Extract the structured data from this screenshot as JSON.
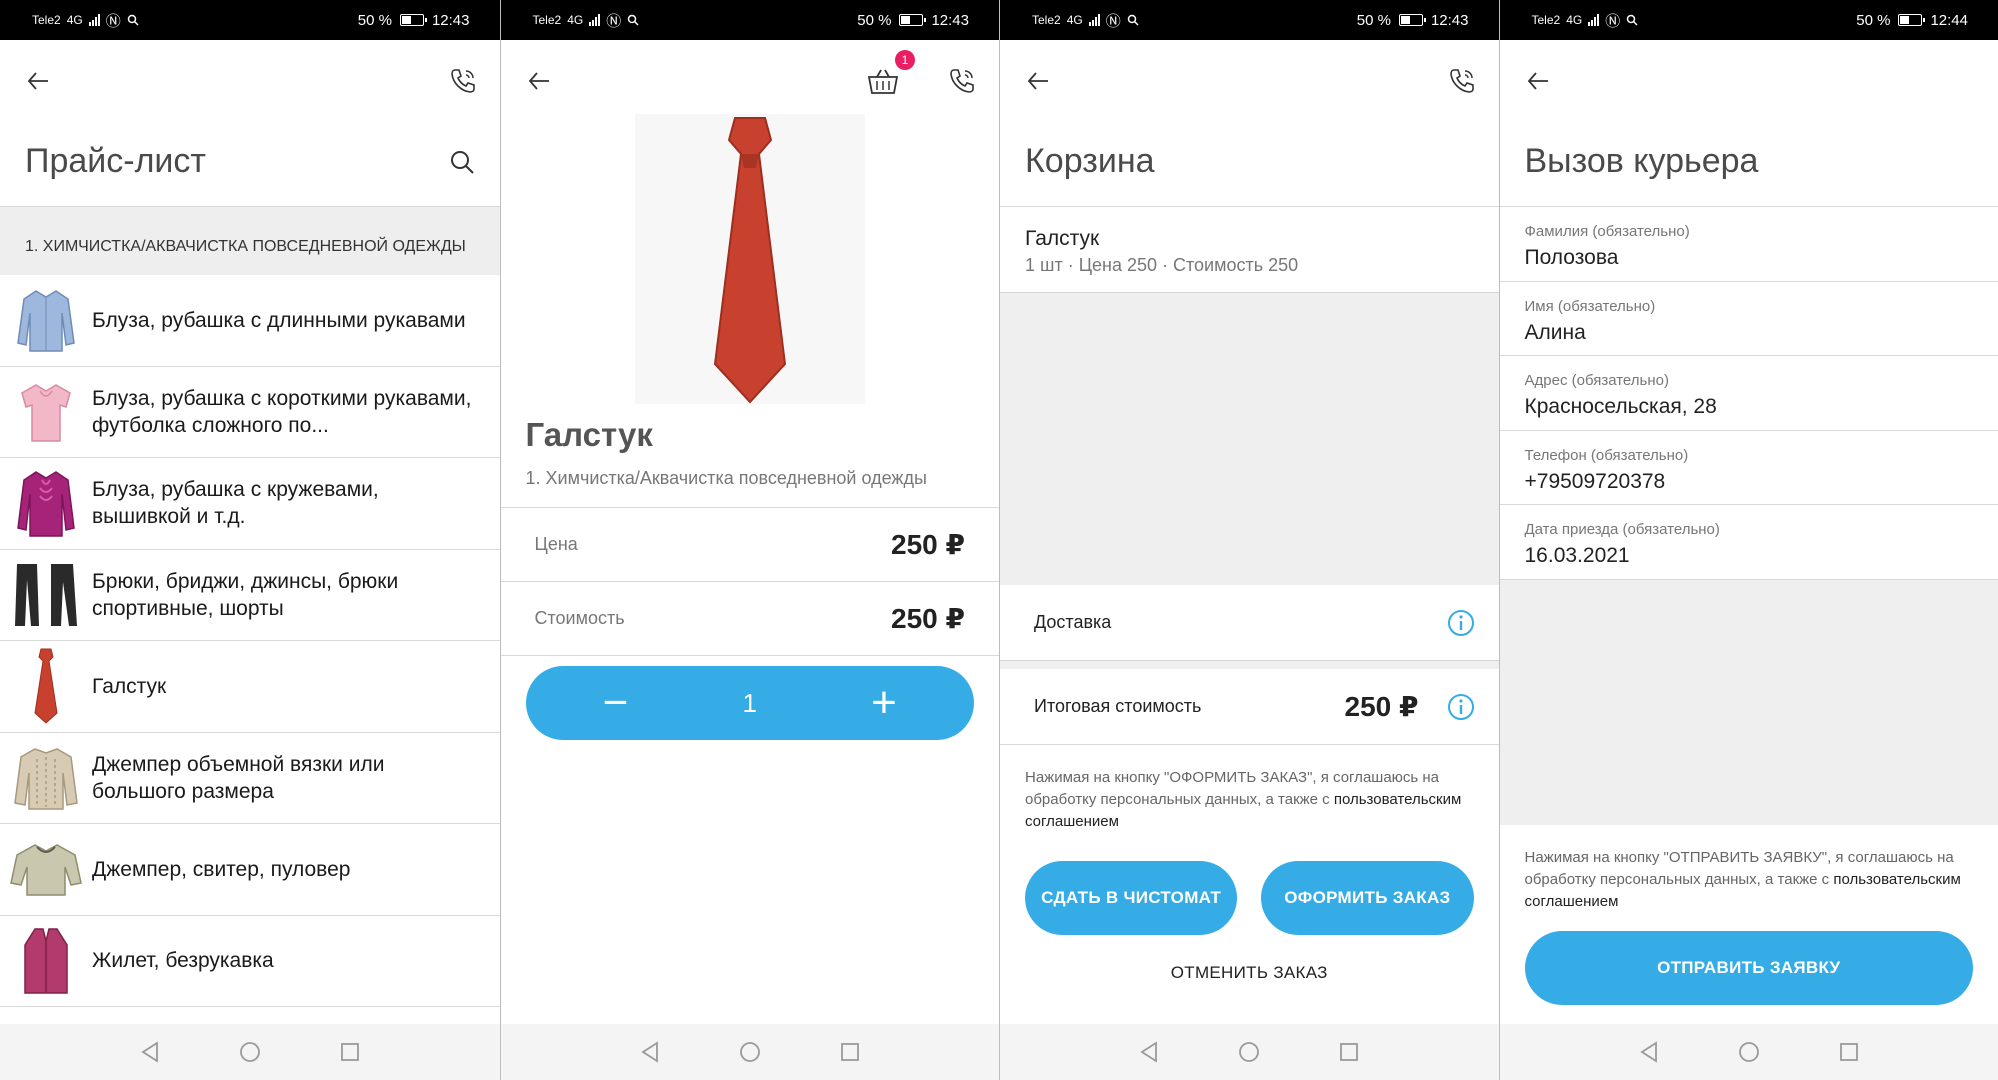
{
  "screens": [
    {
      "status": {
        "carrier": "Tele2",
        "net": "4G",
        "battery": "50 %",
        "time": "12:43"
      },
      "title": "Прайс-лист",
      "section": "1. ХИМЧИСТКА/АКВАЧИСТКА ПОВСЕДНЕВНОЙ ОДЕЖДЫ",
      "items": [
        {
          "label": "Блуза, рубашка с длинными рукавами"
        },
        {
          "label": "Блуза, рубашка с короткими рукавами, футболка сложного по..."
        },
        {
          "label": "Блуза, рубашка с кружевами, вышивкой и т.д."
        },
        {
          "label": "Брюки, бриджи, джинсы, брюки спортивные, шорты"
        },
        {
          "label": "Галстук"
        },
        {
          "label": "Джемпер объемной вязки или большого размера"
        },
        {
          "label": "Джемпер, свитер, пуловер"
        },
        {
          "label": "Жилет, безрукавка"
        }
      ]
    },
    {
      "status": {
        "carrier": "Tele2",
        "net": "4G",
        "battery": "50 %",
        "time": "12:43"
      },
      "cart_count": "1",
      "product": {
        "title": "Галстук",
        "category": "1. Химчистка/Аквачистка повседневной одежды",
        "price_label": "Цена",
        "price_value": "250 ₽",
        "cost_label": "Стоимость",
        "cost_value": "250 ₽",
        "quantity": "1",
        "minus": "−",
        "plus": "+"
      }
    },
    {
      "status": {
        "carrier": "Tele2",
        "net": "4G",
        "battery": "50 %",
        "time": "12:43"
      },
      "title": "Корзина",
      "item": {
        "name": "Галстук",
        "details": "1 шт · Цена 250 · Стоимость 250"
      },
      "delivery_label": "Доставка",
      "total_label": "Итоговая стоимость",
      "total_value": "250 ₽",
      "legal_text": "Нажимая на кнопку \"ОФОРМИТЬ ЗАКАЗ\", я соглашаюсь на обработку персональных данных, а также с",
      "legal_link": "пользовательским соглашением",
      "btn_left": "СДАТЬ В ЧИСТОМАТ",
      "btn_right": "ОФОРМИТЬ ЗАКАЗ",
      "cancel": "ОТМЕНИТЬ ЗАКАЗ"
    },
    {
      "status": {
        "carrier": "Tele2",
        "net": "4G",
        "battery": "50 %",
        "time": "12:44"
      },
      "title": "Вызов курьера",
      "fields": [
        {
          "label": "Фамилия (обязательно)",
          "value": "Полозова"
        },
        {
          "label": "Имя (обязательно)",
          "value": "Алина"
        },
        {
          "label": "Адрес (обязательно)",
          "value": "Красносельская, 28"
        },
        {
          "label": "Телефон (обязательно)",
          "value": "+79509720378"
        },
        {
          "label": "Дата приезда (обязательно)",
          "value": "16.03.2021"
        }
      ],
      "legal_text": "Нажимая на кнопку \"ОТПРАВИТЬ ЗАЯВКУ\", я соглашаюсь на обработку персональных данных, а также с",
      "legal_link": "пользовательским соглашением",
      "submit": "ОТПРАВИТЬ ЗАЯВКУ"
    }
  ],
  "colors": {
    "accent": "#36ace6",
    "badge": "#e91e63",
    "tie": "#c8412e"
  }
}
